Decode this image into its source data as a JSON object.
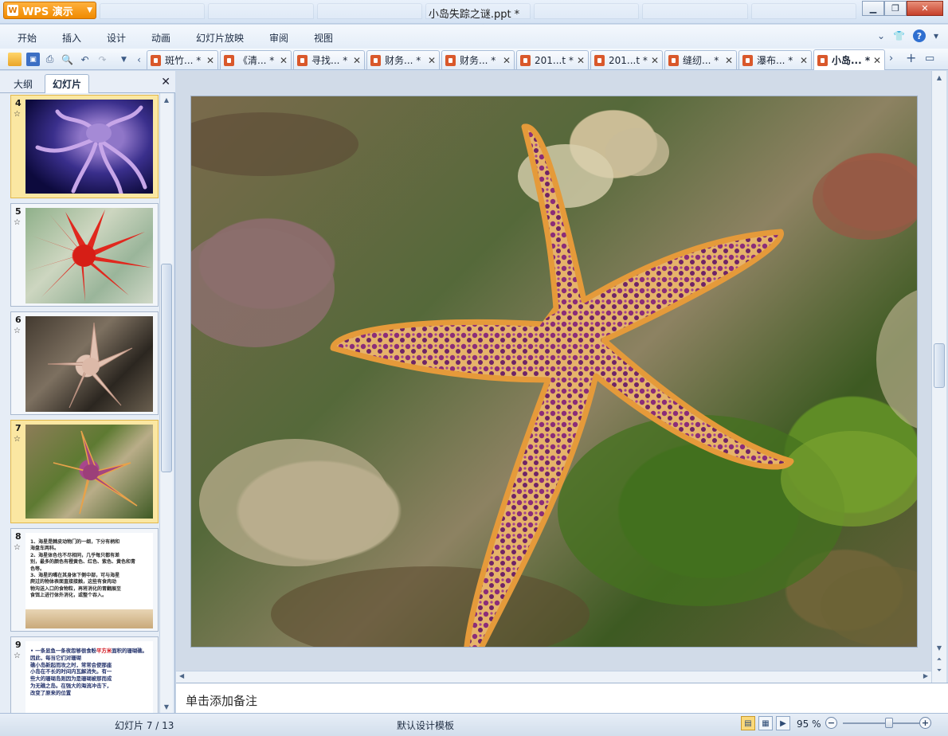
{
  "titlebar": {
    "app_button": "WPS 演示",
    "app_icon": "W",
    "window_title": "小岛失踪之谜.ppt *",
    "minimize_icon": "minimize-icon",
    "restore_icon": "restore-icon",
    "close_icon": "close-icon"
  },
  "menu": {
    "items": [
      "开始",
      "插入",
      "设计",
      "动画",
      "幻灯片放映",
      "审阅",
      "视图"
    ]
  },
  "doc_tabs": [
    {
      "label": "斑竹... *"
    },
    {
      "label": "《清... *"
    },
    {
      "label": "寻找... *"
    },
    {
      "label": "财务... *"
    },
    {
      "label": "财务... *"
    },
    {
      "label": "201...t *"
    },
    {
      "label": "201...t *"
    },
    {
      "label": "缝纫... *"
    },
    {
      "label": "瀑布... *"
    },
    {
      "label": "小岛... *"
    }
  ],
  "left_panel": {
    "tab_outline": "大纲",
    "tab_slides": "幻灯片",
    "slides": [
      {
        "num": "4"
      },
      {
        "num": "5"
      },
      {
        "num": "6"
      },
      {
        "num": "7",
        "selected": true
      },
      {
        "num": "8",
        "text": "1、海星是棘皮动物门的一纲，下分有柄和\n海盘车两科。\n2、海星体色也不尽相同，几乎每只都有差\n别，最多的颜色有橙黄色、红色、紫色、黄色和青\n色等。\n3、海星的嘴在其身体下侧中部，可与海星\n爬过的物体表面直接接触，这些有食肉动\n物沟送入口的食物粒，再将消化的胃翻展至\n食饵上进行体外消化，或整个吞入。"
      },
      {
        "num": "9",
        "text_plain": "• 一条显鱼一条夜怨够很食粉",
        "text_red": "平方米",
        "text_rest": "面积的珊瑚礁。因此，每当它们对珊瑚\n礁小岛新起而攻之时，常常会使那座\n小岛在不长的时间内瓦解消失。有一\n些大的珊瑚岛则因为是珊瑚被那而成\n为无礁之岛。在强大的海流冲击下，\n改变了原来的位置"
      }
    ]
  },
  "notes": {
    "placeholder": "单击添加备注"
  },
  "statusbar": {
    "slide_indicator": "幻灯片 7 / 13",
    "template": "默认设计模板",
    "zoom": "95 %",
    "zoom_fraction": 0.6
  }
}
